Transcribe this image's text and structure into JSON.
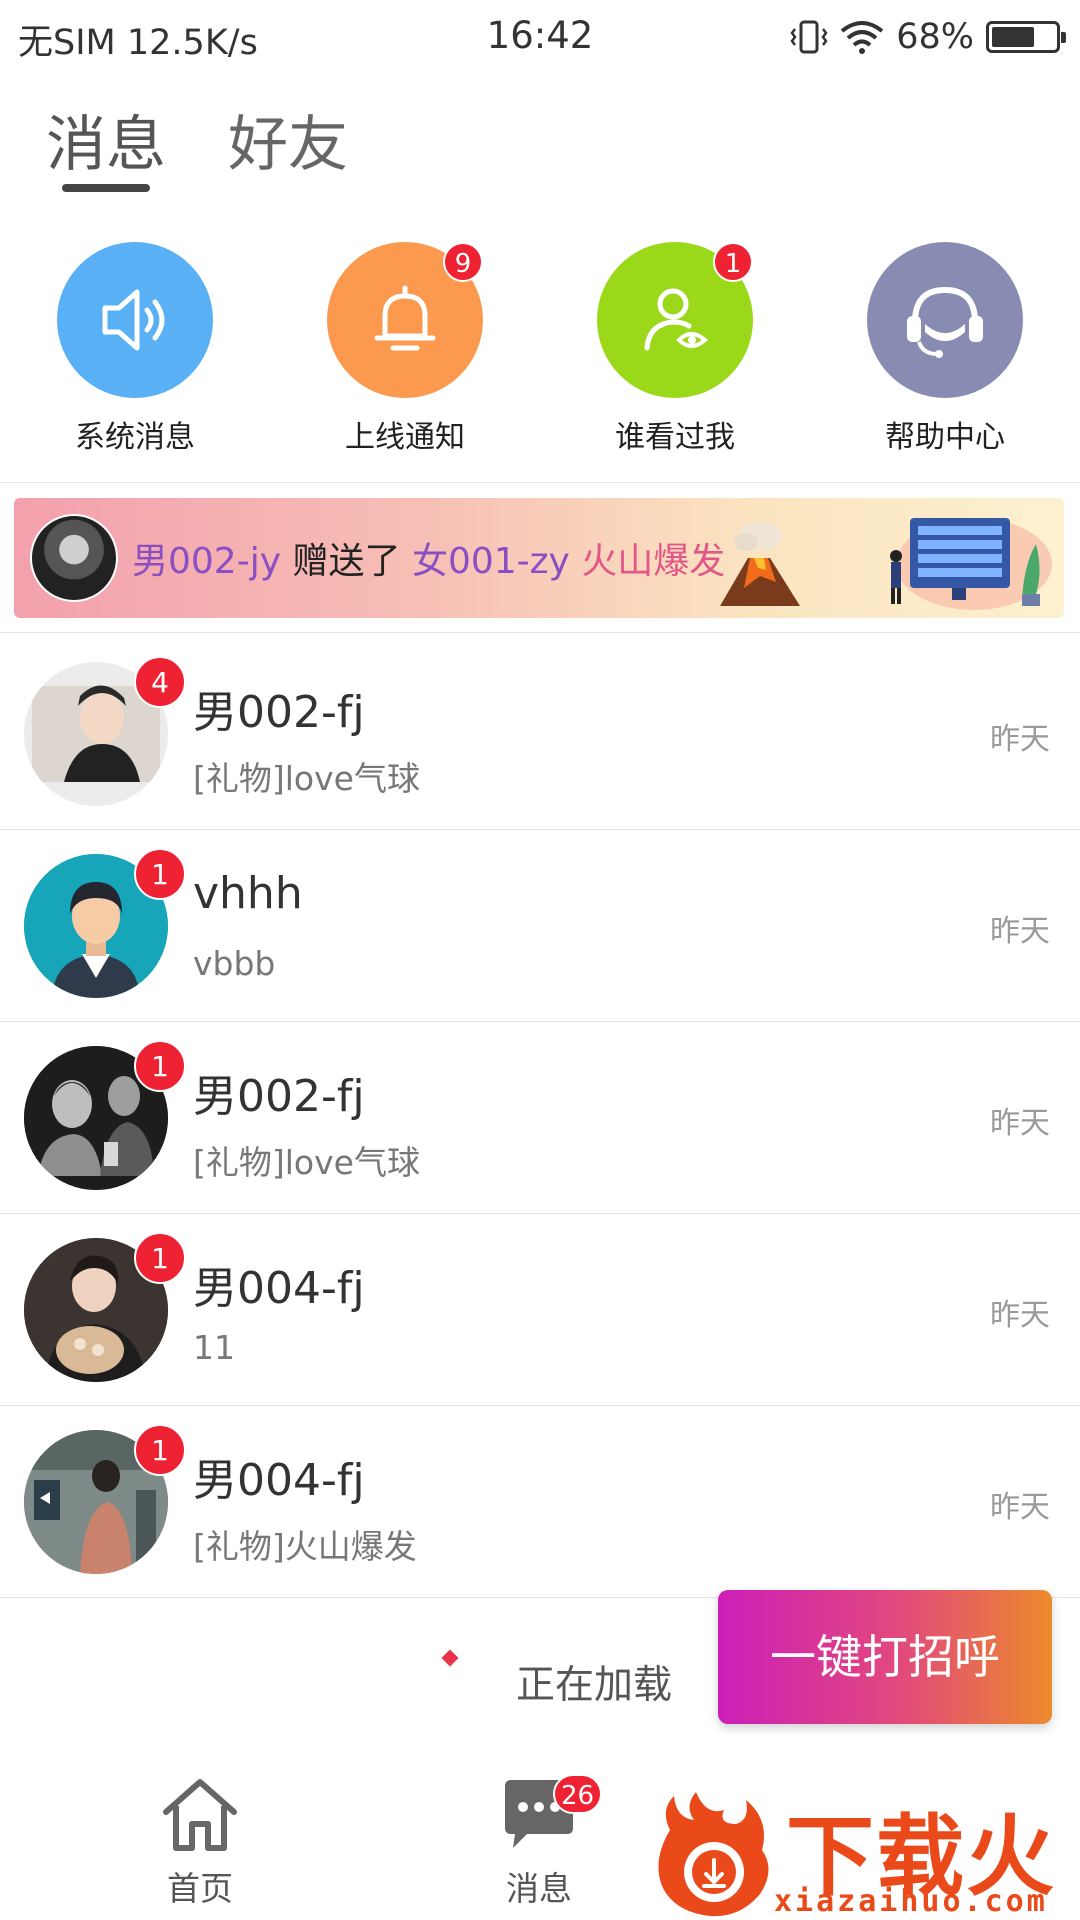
{
  "status_bar": {
    "carrier": "无SIM",
    "speed": "12.5K/s",
    "time": "16:42",
    "battery": "68%",
    "battery_level": 0.68
  },
  "tabs": [
    {
      "label": "消息",
      "active": true
    },
    {
      "label": "好友",
      "active": false
    }
  ],
  "shortcuts": [
    {
      "label": "系统消息",
      "icon": "speaker-icon",
      "color": "#5ab0f5",
      "badge": ""
    },
    {
      "label": "上线通知",
      "icon": "bell-icon",
      "color": "#fb9a4e",
      "badge": "9"
    },
    {
      "label": "谁看过我",
      "icon": "user-eye-icon",
      "color": "#9cd81a",
      "badge": "1"
    },
    {
      "label": "帮助中心",
      "icon": "headset-icon",
      "color": "#888cb3",
      "badge": ""
    }
  ],
  "banner": {
    "sender": "男002-jy",
    "verb": "赠送了",
    "receiver": "女001-zy",
    "gift": "火山爆发"
  },
  "messages": [
    {
      "name": "男002-fj",
      "preview": "[礼物]love气球",
      "time": "昨天",
      "badge": "4"
    },
    {
      "name": "vhhh",
      "preview": "vbbb",
      "time": "昨天",
      "badge": "1"
    },
    {
      "name": "男002-fj",
      "preview": "[礼物]love气球",
      "time": "昨天",
      "badge": "1"
    },
    {
      "name": "男004-fj",
      "preview": "11",
      "time": "昨天",
      "badge": "1"
    },
    {
      "name": "男004-fj",
      "preview": "[礼物]火山爆发",
      "time": "昨天",
      "badge": "1"
    }
  ],
  "loading_text": "正在加载",
  "greet_button": "一键打招呼",
  "bottom_nav": [
    {
      "label": "首页",
      "icon": "home-icon"
    },
    {
      "label": "消息",
      "icon": "chat-bubble-icon",
      "badge": "26"
    }
  ],
  "watermark": {
    "title": "下载火",
    "url": "xiazaihuo.com"
  },
  "colors": {
    "badge_red": "#ee2233",
    "tab_underline": "#444444",
    "greet_gradient_start": "#cc1eb9",
    "greet_gradient_end": "#ec8a2c"
  }
}
